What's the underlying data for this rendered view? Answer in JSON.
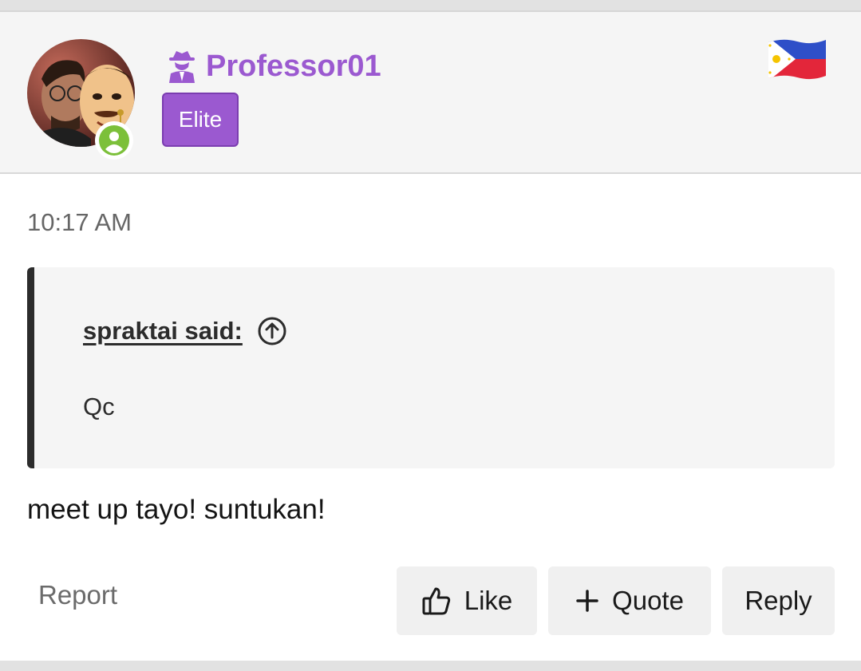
{
  "author": {
    "username": "Professor01",
    "badge": "Elite",
    "status": "online",
    "country_flag": "Philippines"
  },
  "post": {
    "time": "10:17 AM",
    "quote": {
      "author_label": "spraktai said:",
      "text": "Qc"
    },
    "message": "meet up tayo! suntukan!"
  },
  "actions": {
    "report": "Report",
    "like": "Like",
    "quote": "Quote",
    "reply": "Reply"
  },
  "colors": {
    "accent": "#9b59d0",
    "online": "#7cc03a",
    "quote_bar": "#2c2c2c"
  },
  "icons": [
    "user-circle-icon",
    "spy-icon",
    "philippines-flag-icon",
    "arrow-up-circle-icon",
    "thumbs-up-icon",
    "plus-icon"
  ]
}
